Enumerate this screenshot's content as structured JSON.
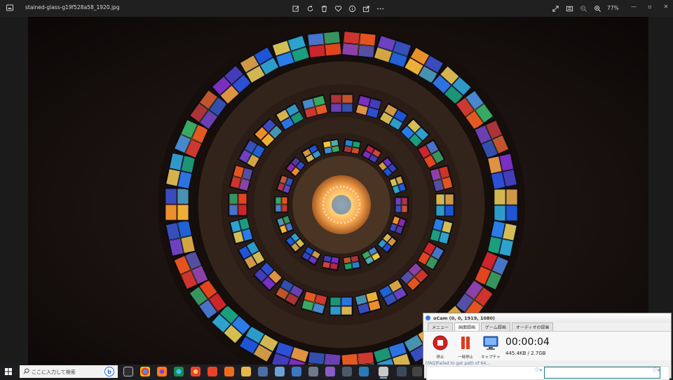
{
  "viewer": {
    "filename": "stained-glass-g19f528a58_1920.jpg",
    "zoom": "77%",
    "toolbar_icons": [
      "edit-icon",
      "rotate-icon",
      "delete-icon",
      "favorite-icon",
      "info-icon",
      "share-icon",
      "more-icon"
    ],
    "right_icons": [
      "fullscreen-icon",
      "slideshow-icon",
      "zoom-out-icon",
      "zoom-in-icon"
    ]
  },
  "window_controls": {
    "minimize": "—",
    "maximize": "▫",
    "close": "✕"
  },
  "ocam": {
    "title": "oCam (0, 0, 1919, 1080)",
    "tabs": [
      "メニュー",
      "画面録画",
      "ゲーム録画",
      "オーディオの録画"
    ],
    "active_tab": 1,
    "buttons": {
      "stop": "停止",
      "pause": "一時停止",
      "capture": "キャプチャ"
    },
    "timer": "00:00:04",
    "size": "445.4KB / 2.7GB",
    "status": "[FAQ]Failed to get path of 64..."
  },
  "taskbar": {
    "search_placeholder": "ここに入力して検索",
    "bing": "b"
  },
  "colors": {
    "accent": "#2a6fd8",
    "record_red": "#d62020",
    "pause_red": "#e03a1e"
  }
}
